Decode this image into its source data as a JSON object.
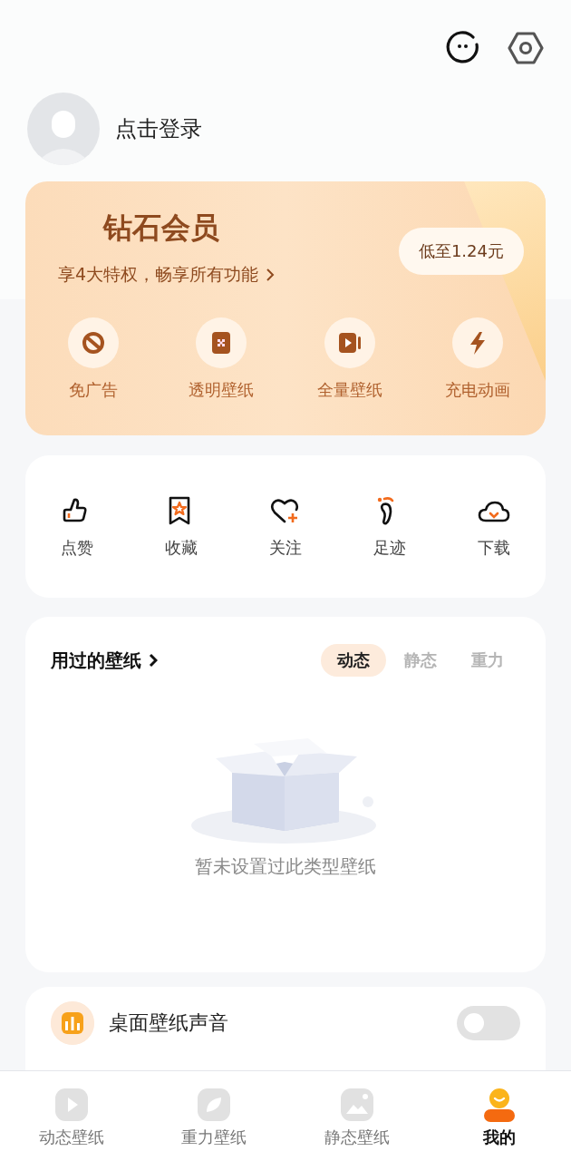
{
  "profile": {
    "login_text": "点击登录"
  },
  "vip": {
    "title": "钻石会员",
    "subtitle": "享4大特权，畅享所有功能",
    "price_button": "低至1.24元",
    "perks": [
      {
        "label": "免广告"
      },
      {
        "label": "透明壁纸"
      },
      {
        "label": "全量壁纸"
      },
      {
        "label": "充电动画"
      }
    ]
  },
  "actions": [
    {
      "label": "点赞"
    },
    {
      "label": "收藏"
    },
    {
      "label": "关注"
    },
    {
      "label": "足迹"
    },
    {
      "label": "下载"
    }
  ],
  "used_wallpapers": {
    "title": "用过的壁纸",
    "tabs": [
      {
        "label": "动态",
        "selected": true
      },
      {
        "label": "静态",
        "selected": false
      },
      {
        "label": "重力",
        "selected": false
      }
    ],
    "empty_text": "暂未设置过此类型壁纸"
  },
  "sound_setting": {
    "label": "桌面壁纸声音",
    "on": false
  },
  "bottom_nav": [
    {
      "label": "动态壁纸",
      "selected": false
    },
    {
      "label": "重力壁纸",
      "selected": false
    },
    {
      "label": "静态壁纸",
      "selected": false
    },
    {
      "label": "我的",
      "selected": true
    }
  ]
}
